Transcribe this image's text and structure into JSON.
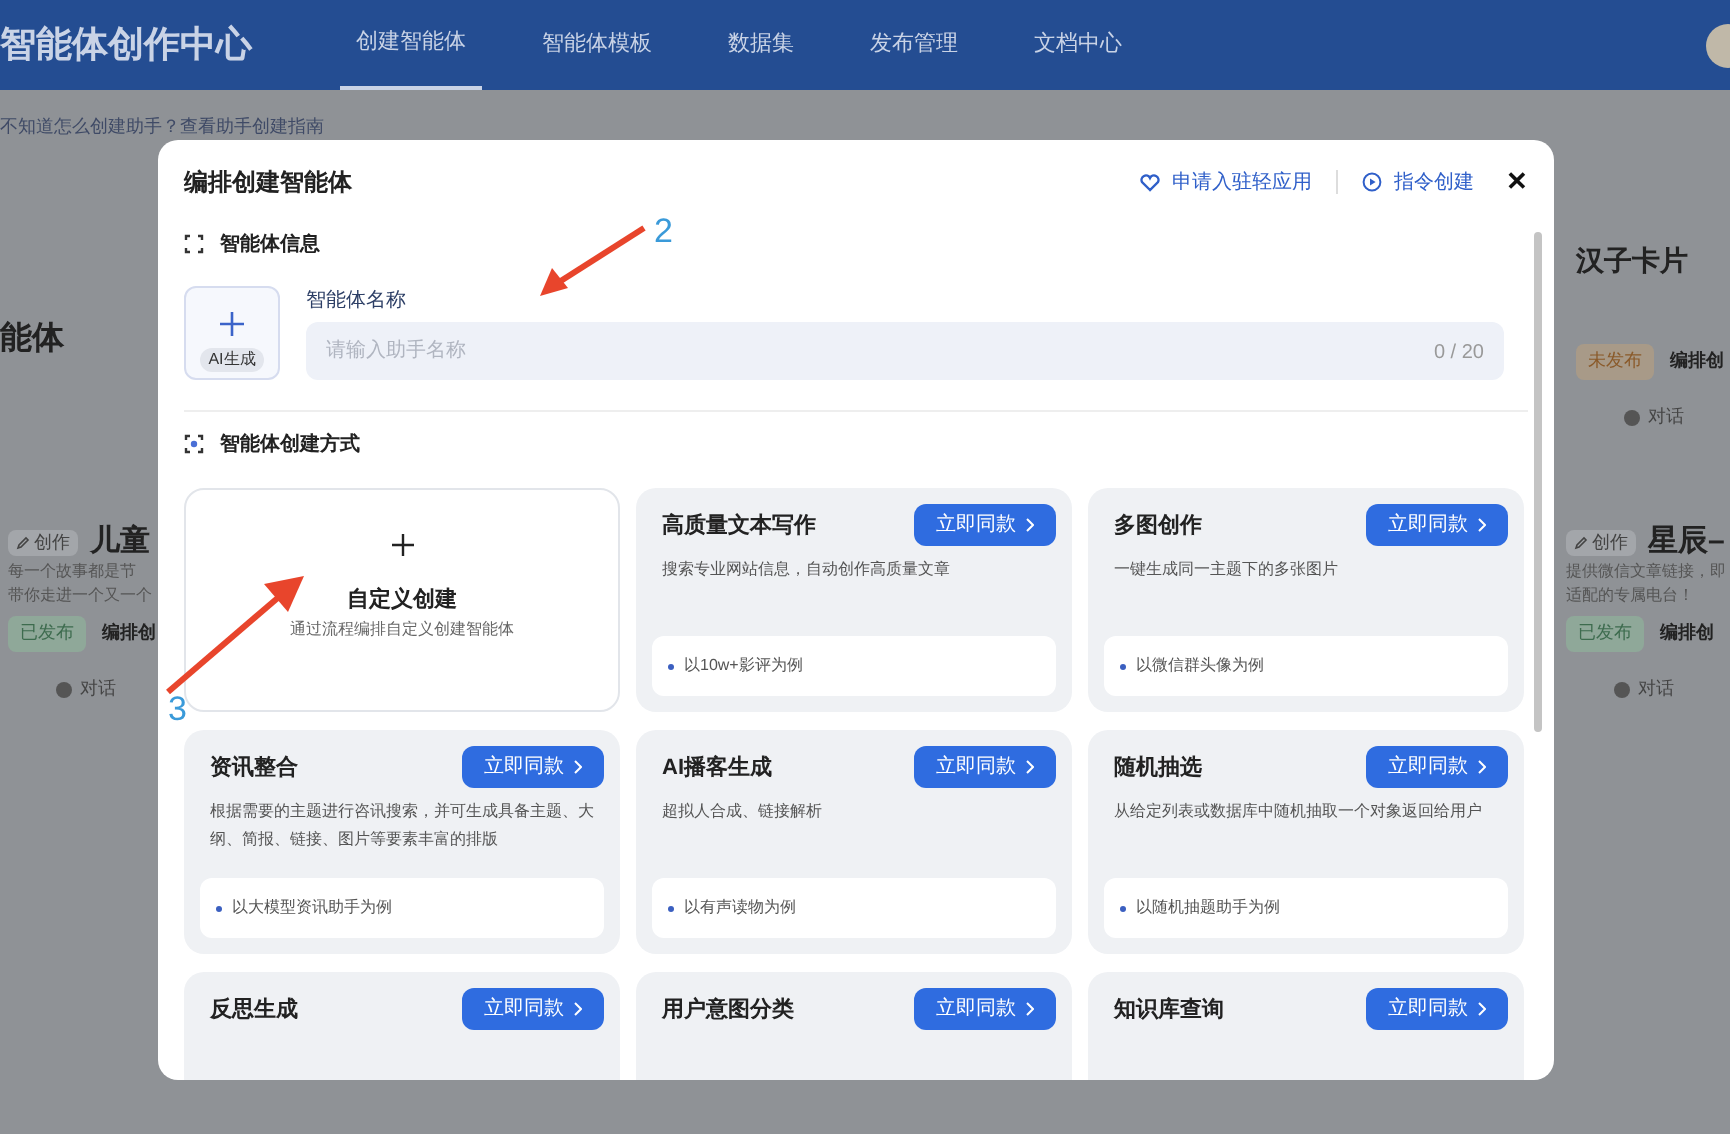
{
  "header": {
    "title": "智能体创作中心",
    "nav": [
      {
        "label": "创建智能体",
        "selected": true
      },
      {
        "label": "智能体模板",
        "selected": false
      },
      {
        "label": "数据集",
        "selected": false
      },
      {
        "label": "发布管理",
        "selected": false
      },
      {
        "label": "文档中心",
        "selected": false
      }
    ]
  },
  "background": {
    "hint": "不知道怎么创建助手？查看助手创建指南",
    "left_heading": "能体",
    "left_card": {
      "tag": "创作",
      "title": "儿童",
      "desc": [
        "每一个故事都是节",
        "带你走进一个又一个"
      ],
      "status": "已发布",
      "mode": "编排创",
      "chat": "对话"
    },
    "right_top": {
      "title": "汉子卡片",
      "status": "未发布",
      "mode": "编排创",
      "chat": "对话"
    },
    "right_card": {
      "tag": "创作",
      "title": "星辰–",
      "desc": [
        "提供微信文章链接，即",
        "适配的专属电台！"
      ],
      "status": "已发布",
      "mode": "编排创",
      "chat": "对话"
    }
  },
  "modal": {
    "title": "编排创建智能体",
    "actions": [
      "申请入驻轻应用",
      "指令创建"
    ],
    "close": "✕",
    "info_section": "智能体信息",
    "ai_button": "AI生成",
    "name_label": "智能体名称",
    "name_placeholder": "请输入助手名称",
    "name_counter": "0 / 20",
    "method_section": "智能体创建方式",
    "cards": [
      {
        "kind": "custom",
        "title": "自定义创建",
        "desc": "通过流程编排自定义创建智能体"
      },
      {
        "kind": "template",
        "title": "高质量文本写作",
        "button": "立即同款",
        "desc": "搜索专业网站信息，自动创作高质量文章",
        "example": "以10w+影评为例"
      },
      {
        "kind": "template",
        "title": "多图创作",
        "button": "立即同款",
        "desc": "一键生成同一主题下的多张图片",
        "example": "以微信群头像为例"
      },
      {
        "kind": "template",
        "title": "资讯整合",
        "button": "立即同款",
        "desc": "根据需要的主题进行咨讯搜索，并可生成具备主题、大纲、简报、链接、图片等要素丰富的排版",
        "example": "以大模型资讯助手为例"
      },
      {
        "kind": "template",
        "title": "AI播客生成",
        "button": "立即同款",
        "desc": "超拟人合成、链接解析",
        "example": "以有声读物为例"
      },
      {
        "kind": "template",
        "title": "随机抽选",
        "button": "立即同款",
        "desc": "从给定列表或数据库中随机抽取一个对象返回给用户",
        "example": "以随机抽题助手为例"
      },
      {
        "kind": "template",
        "title": "反思生成",
        "button": "立即同款"
      },
      {
        "kind": "template",
        "title": "用户意图分类",
        "button": "立即同款"
      },
      {
        "kind": "template",
        "title": "知识库查询",
        "button": "立即同款"
      }
    ]
  },
  "annotations": [
    "2",
    "3"
  ]
}
